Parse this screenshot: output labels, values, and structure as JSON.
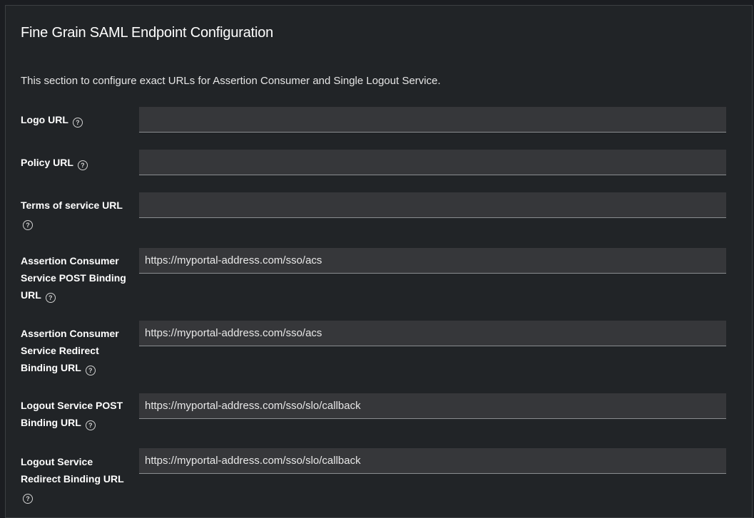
{
  "section": {
    "title": "Fine Grain SAML Endpoint Configuration",
    "description": "This section to configure exact URLs for Assertion Consumer and Single Logout Service."
  },
  "fields": [
    {
      "label": "Logo URL",
      "value": "",
      "help_icon": "question-circle-icon"
    },
    {
      "label": "Policy URL",
      "value": "",
      "help_icon": "question-circle-icon"
    },
    {
      "label": "Terms of service URL",
      "value": "",
      "help_icon": "question-circle-icon"
    },
    {
      "label": "Assertion Consumer Service POST Binding URL",
      "value": "https://myportal-address.com/sso/acs",
      "help_icon": "question-circle-icon"
    },
    {
      "label": "Assertion Consumer Service Redirect Binding URL",
      "value": "https://myportal-address.com/sso/acs",
      "help_icon": "question-circle-icon"
    },
    {
      "label": "Logout Service POST Binding URL",
      "value": "https://myportal-address.com/sso/slo/callback",
      "help_icon": "question-circle-icon"
    },
    {
      "label": "Logout Service Redirect Binding URL",
      "value": "https://myportal-address.com/sso/slo/callback",
      "help_icon": "question-circle-icon"
    }
  ],
  "colors": {
    "background": "#212427",
    "input_background": "#36373a",
    "input_border": "#8a8d90",
    "text": "#ffffff"
  }
}
